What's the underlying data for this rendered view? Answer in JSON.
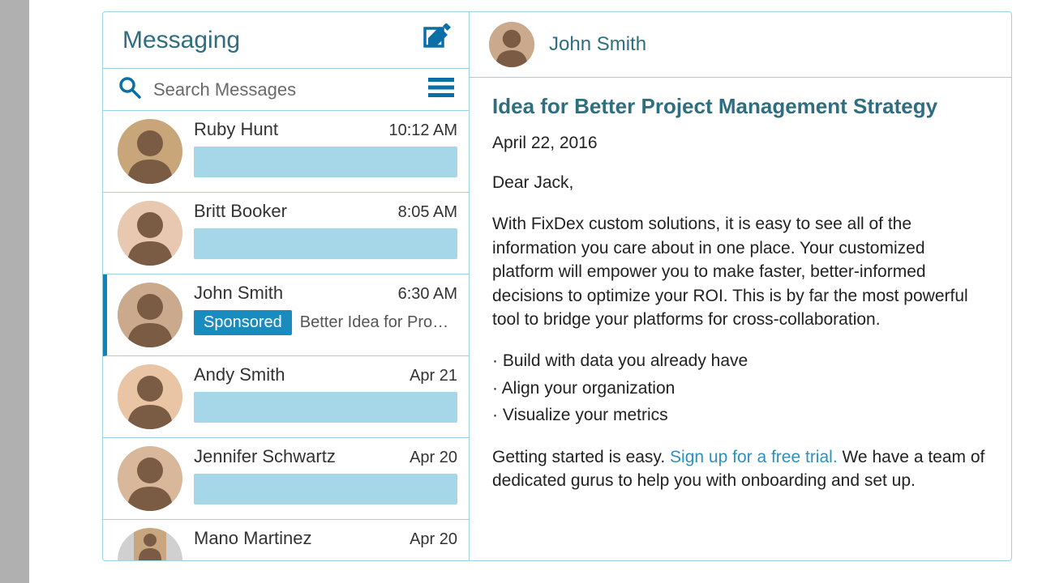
{
  "header": {
    "title": "Messaging",
    "search_placeholder": "Search Messages"
  },
  "messages": [
    {
      "name": "Ruby Hunt",
      "time": "10:12 AM",
      "selected": false,
      "sponsored": false,
      "preview": ""
    },
    {
      "name": "Britt Booker",
      "time": "8:05 AM",
      "selected": false,
      "sponsored": false,
      "preview": ""
    },
    {
      "name": "John Smith",
      "time": "6:30 AM",
      "selected": true,
      "sponsored": true,
      "sponsored_label": "Sponsored",
      "preview": "Better Idea for Pro…"
    },
    {
      "name": "Andy Smith",
      "time": "Apr 21",
      "selected": false,
      "sponsored": false,
      "preview": ""
    },
    {
      "name": "Jennifer Schwartz",
      "time": "Apr 20",
      "selected": false,
      "sponsored": false,
      "preview": ""
    },
    {
      "name": "Mano Martinez",
      "time": "Apr 20",
      "selected": false,
      "sponsored": false,
      "preview": "",
      "partial": true
    }
  ],
  "detail": {
    "sender": "John Smith",
    "subject": "Idea for Better Project Management Strategy",
    "date": "April 22, 2016",
    "greeting": "Dear Jack,",
    "para1": "With FixDex custom solutions, it is easy to see all of the information you care about in one place. Your customized platform will empower you to make faster, better-informed decisions to optimize your ROI. This is by far the most powerful tool to bridge your platforms for cross-collaboration.",
    "bullet1": "· Build with data you already have",
    "bullet2": "· Align your organization",
    "bullet3": "· Visualize your metrics",
    "closing_pre": "Getting started is easy.  ",
    "closing_link": "Sign up for a free trial.",
    "closing_post": "  We have a team of dedicated gurus to help you with onboarding and set up."
  },
  "avatar_colors": [
    "#c9a67a",
    "#e8c8b0",
    "#caa98c",
    "#e9c4a5",
    "#d8b79a",
    "#c8a680"
  ]
}
